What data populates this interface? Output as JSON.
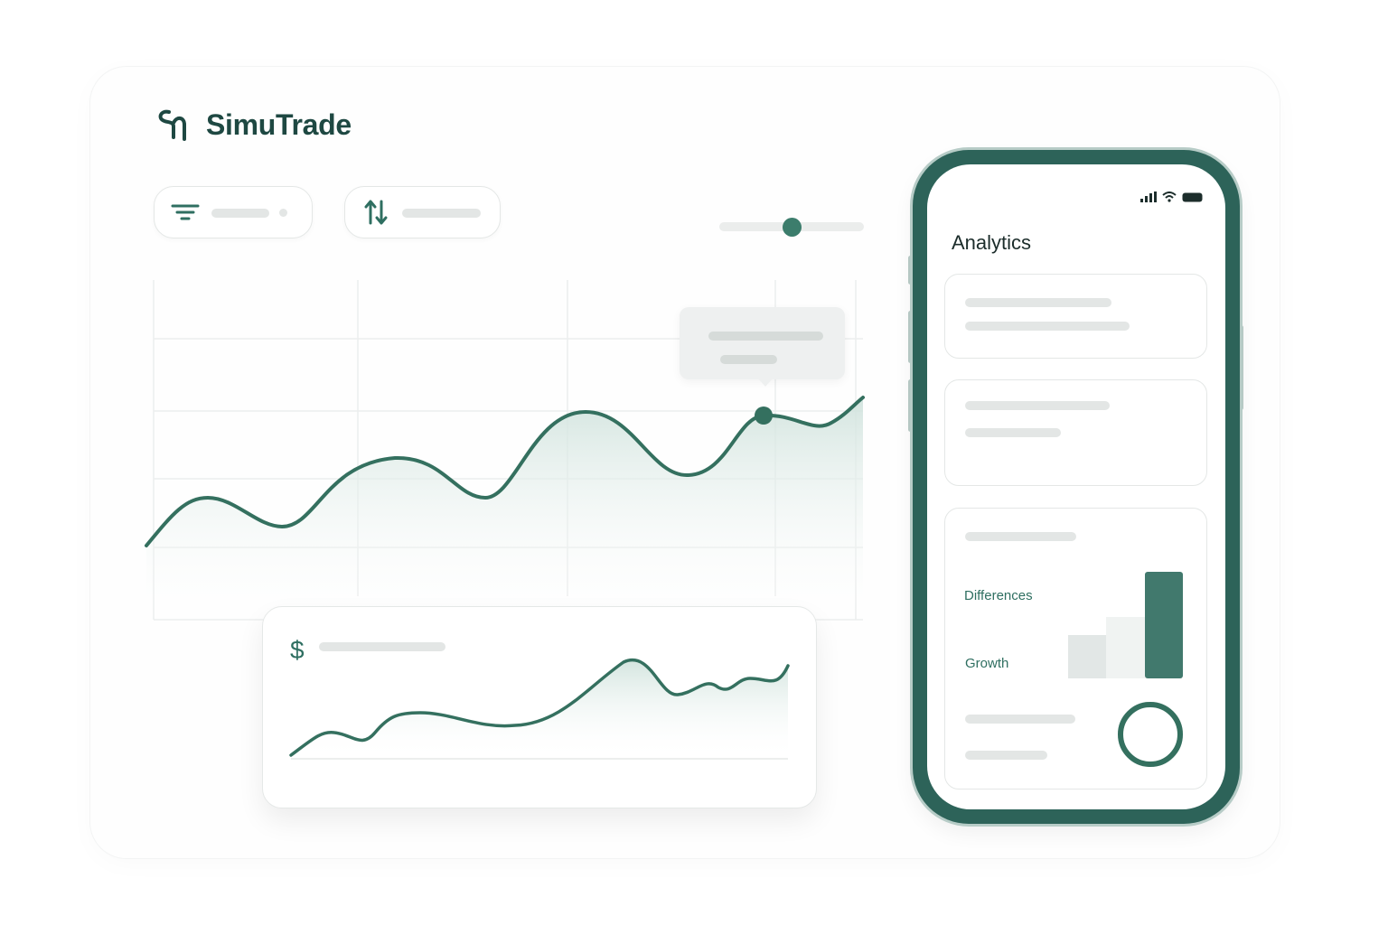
{
  "brand": {
    "name": "SimuTrade",
    "logo_icon": "simutrade-logo-icon"
  },
  "toolbar": {
    "filter_icon": "filter-icon",
    "sort_icon": "sort-arrows-icon"
  },
  "slider": {
    "value": 0.5
  },
  "colors": {
    "accent": "#3c7d6c",
    "accent_dark": "#2d6359",
    "muted": "#e3e6e5",
    "frame_light": "#b7ccc7"
  },
  "main_chart": {
    "type": "area",
    "highlighted_point": "tooltip-marker",
    "grid": true
  },
  "mini_chart": {
    "type": "area",
    "currency_symbol": "$"
  },
  "phone": {
    "title": "Analytics",
    "status_icons": [
      "signal-icon",
      "wifi-icon",
      "battery-icon"
    ],
    "labels": {
      "differences": "Differences",
      "growth": "Growth"
    },
    "bar_values": [
      0.41,
      0.58,
      1.0
    ],
    "donut_value": 1.0
  }
}
